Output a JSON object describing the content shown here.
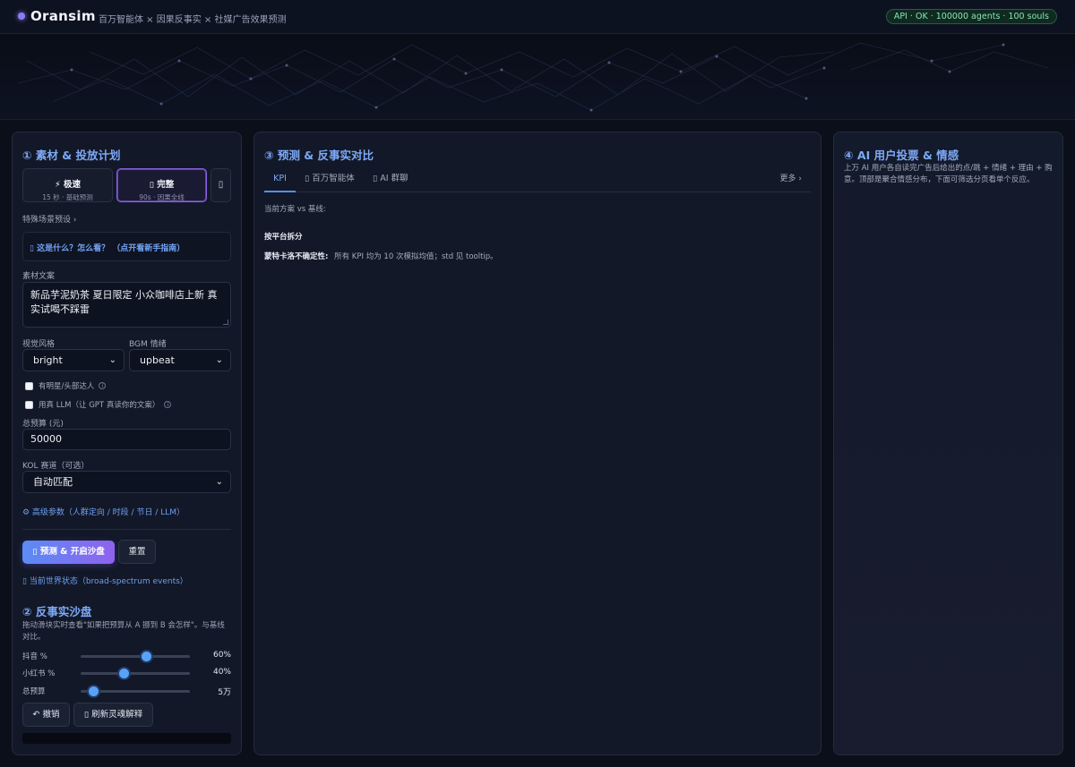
{
  "header": {
    "brand": "Oransim",
    "tagline": "百万智能体 × 因果反事实 × 社媒广告效果预测",
    "api_status": "API · OK · 100000 agents · 100 souls"
  },
  "left_panel": {
    "title": "① 素材 & 投放计划",
    "modes": [
      {
        "title": "⚡ 极速",
        "subtitle": "15 秒 · 基础预测"
      },
      {
        "title": "▯ 完整",
        "subtitle": "90s · 因果全线"
      }
    ],
    "mode_more": "▯",
    "special_scene": "特殊场景预设 ›",
    "guide_link": "▯ 这是什么？怎么看？ （点开看新手指南）",
    "copy_label": "素材文案",
    "copy_value": "新品芋泥奶茶 夏日限定 小众咖啡店上新 真实试喝不踩雷",
    "visual_style_label": "视觉风格",
    "visual_style_value": "bright",
    "bgm_label": "BGM 情绪",
    "bgm_value": "upbeat",
    "check_star": "有明星/头部达人",
    "check_llm": "用真 LLM（让 GPT 真读你的文案）",
    "info_glyph": "i",
    "budget_label": "总预算 (元)",
    "budget_value": "50000",
    "kol_label": "KOL 赛道（可选）",
    "kol_value": "自动匹配",
    "advanced_link": "⚙ 高级参数（人群定向 / 时段 / 节日 / LLM）",
    "predict_button": "▯ 预测 & 开启沙盘",
    "reset_button": "重置",
    "world_state_link": "▯ 当前世界状态（broad-spectrum events）"
  },
  "sandbox": {
    "title": "② 反事实沙盘",
    "description": "拖动滑块实时查看\"如果把预算从 A 挪到 B 会怎样\"。与基线对比。",
    "sliders": [
      {
        "label": "抖音 %",
        "value_text": "60%",
        "fraction": 0.6
      },
      {
        "label": "小红书 %",
        "value_text": "40%",
        "fraction": 0.4
      },
      {
        "label": "总预算",
        "value_text": "5万",
        "fraction": 0.12
      }
    ],
    "undo_button": "↶ 撤销",
    "refresh_button": "▯ 刷新灵魂解释"
  },
  "mid_panel": {
    "title": "③ 预测 & 反事实对比",
    "tabs": [
      "KPI",
      "▯ 百万智能体",
      "▯ AI 群聊"
    ],
    "more": "更多 ›",
    "vs_baseline": "当前方案 vs 基线:",
    "by_platform": "按平台拆分",
    "mc_label": "蒙特卡洛不确定性:",
    "mc_text": "所有 KPI 均为 10 次模拟均值；std 见 tooltip。"
  },
  "right_panel": {
    "title": "④ AI 用户投票 & 情感",
    "description": "上万 AI 用户各自读完广告后给出的点/跳 + 情绪 + 理由 + 购意。顶部是聚合情感分布，下面可筛选分页看单个反应。"
  },
  "colors": {
    "accent_blue": "#7ea9f7",
    "accent_purple": "#8f62ee",
    "api_ok_green": "#8be3b0",
    "background": "#0b0f1a"
  }
}
